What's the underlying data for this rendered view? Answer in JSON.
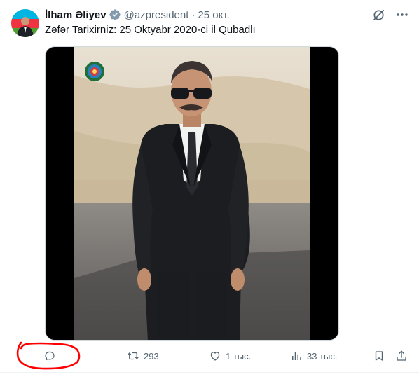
{
  "tweet": {
    "author_name": "İlham Əliyev",
    "handle": "@azpresident",
    "separator": "·",
    "date": "25 окт.",
    "text": "Zəfər Tarixirniz: 25 Oktyabr 2020-ci il Qubadlı"
  },
  "actions": {
    "reply_count": "",
    "retweet_count": "293",
    "like_count": "1 тыс.",
    "views_count": "33 тыс."
  },
  "icons": {
    "verified": "verified-badge-icon",
    "grok": "grok-icon",
    "more": "more-icon",
    "reply": "reply-icon",
    "retweet": "retweet-icon",
    "like": "heart-icon",
    "views": "views-icon",
    "bookmark": "bookmark-icon",
    "share": "share-icon",
    "emblem": "emblem-icon"
  },
  "colors": {
    "text": "#0f1419",
    "secondary": "#536471",
    "verified": "#1d9bf0",
    "highlight": "#ff0000"
  }
}
